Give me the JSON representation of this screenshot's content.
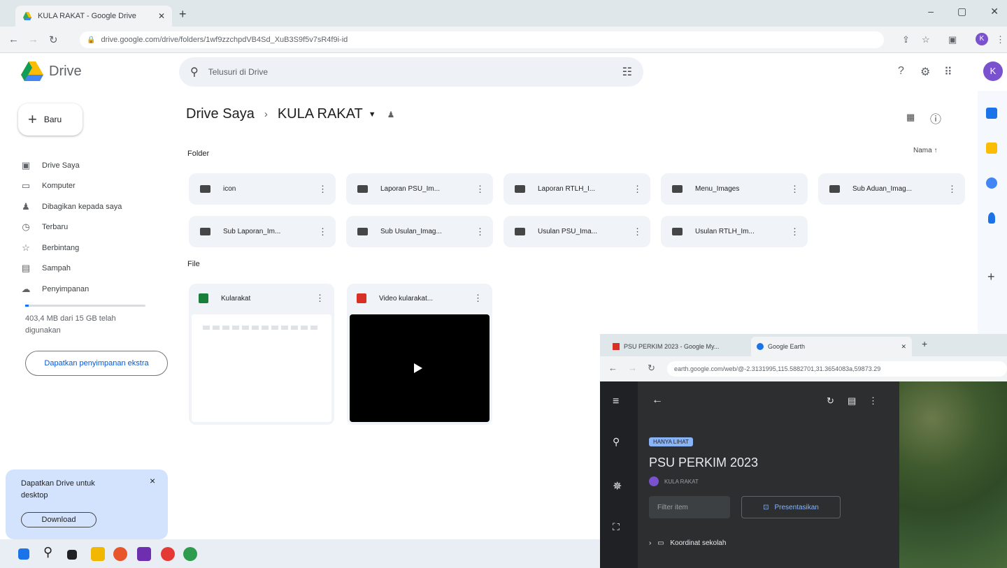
{
  "browser": {
    "tab_title": "KULA RAKAT - Google Drive",
    "url": "drive.google.com/drive/folders/1wf9zzchpdVB4Sd_XuB3S9f5v7sR4f9i-id"
  },
  "drive": {
    "app_name": "Drive",
    "search_placeholder": "Telusuri di Drive",
    "avatar_letter": "K",
    "new_button": "Baru",
    "nav": [
      {
        "label": "Drive Saya"
      },
      {
        "label": "Komputer"
      },
      {
        "label": "Dibagikan kepada saya"
      },
      {
        "label": "Terbaru"
      },
      {
        "label": "Berbintang"
      },
      {
        "label": "Sampah"
      },
      {
        "label": "Penyimpanan"
      }
    ],
    "storage_used_fraction": 0.03,
    "storage_text": "403,4 MB dari 15 GB telah digunakan",
    "more_storage": "Dapatkan penyimpanan ekstra",
    "promo_text": "Dapatkan Drive untuk desktop",
    "promo_close": "×",
    "download_button": "Download",
    "breadcrumb_root": "Drive Saya",
    "breadcrumb_sep": "›",
    "breadcrumb_current": "KULA RAKAT",
    "folders_label": "Folder",
    "sort_label": "Nama",
    "folders": [
      {
        "name": "icon"
      },
      {
        "name": "Laporan PSU_Im..."
      },
      {
        "name": "Laporan RTLH_I..."
      },
      {
        "name": "Menu_Images"
      },
      {
        "name": "Sub Aduan_Imag..."
      },
      {
        "name": "Sub Laporan_Im..."
      },
      {
        "name": "Sub Usulan_Imag..."
      },
      {
        "name": "Usulan PSU_Ima..."
      },
      {
        "name": "Usulan RTLH_Im..."
      }
    ],
    "files_label": "File",
    "files": [
      {
        "name": "Kularakat",
        "type_color": "#188038"
      },
      {
        "name": "Video kularakat...",
        "type_color": "#d93025"
      }
    ]
  },
  "earth": {
    "tab1": "PSU PERKIM 2023 - Google My...",
    "tab2": "Google Earth",
    "url": "earth.google.com/web/@-2.3131995,115.5882701,31.3654083a,59873.29",
    "badge": "HANYA LIHAT",
    "project_title": "PSU PERKIM 2023",
    "owner": "KULA RAKAT",
    "filter_placeholder": "Filter item",
    "present_button": "Presentasikan",
    "list_item": "Koordinat sekolah"
  },
  "colors": {
    "accent": "#1a73e8",
    "avatar": "#7b52ce"
  }
}
